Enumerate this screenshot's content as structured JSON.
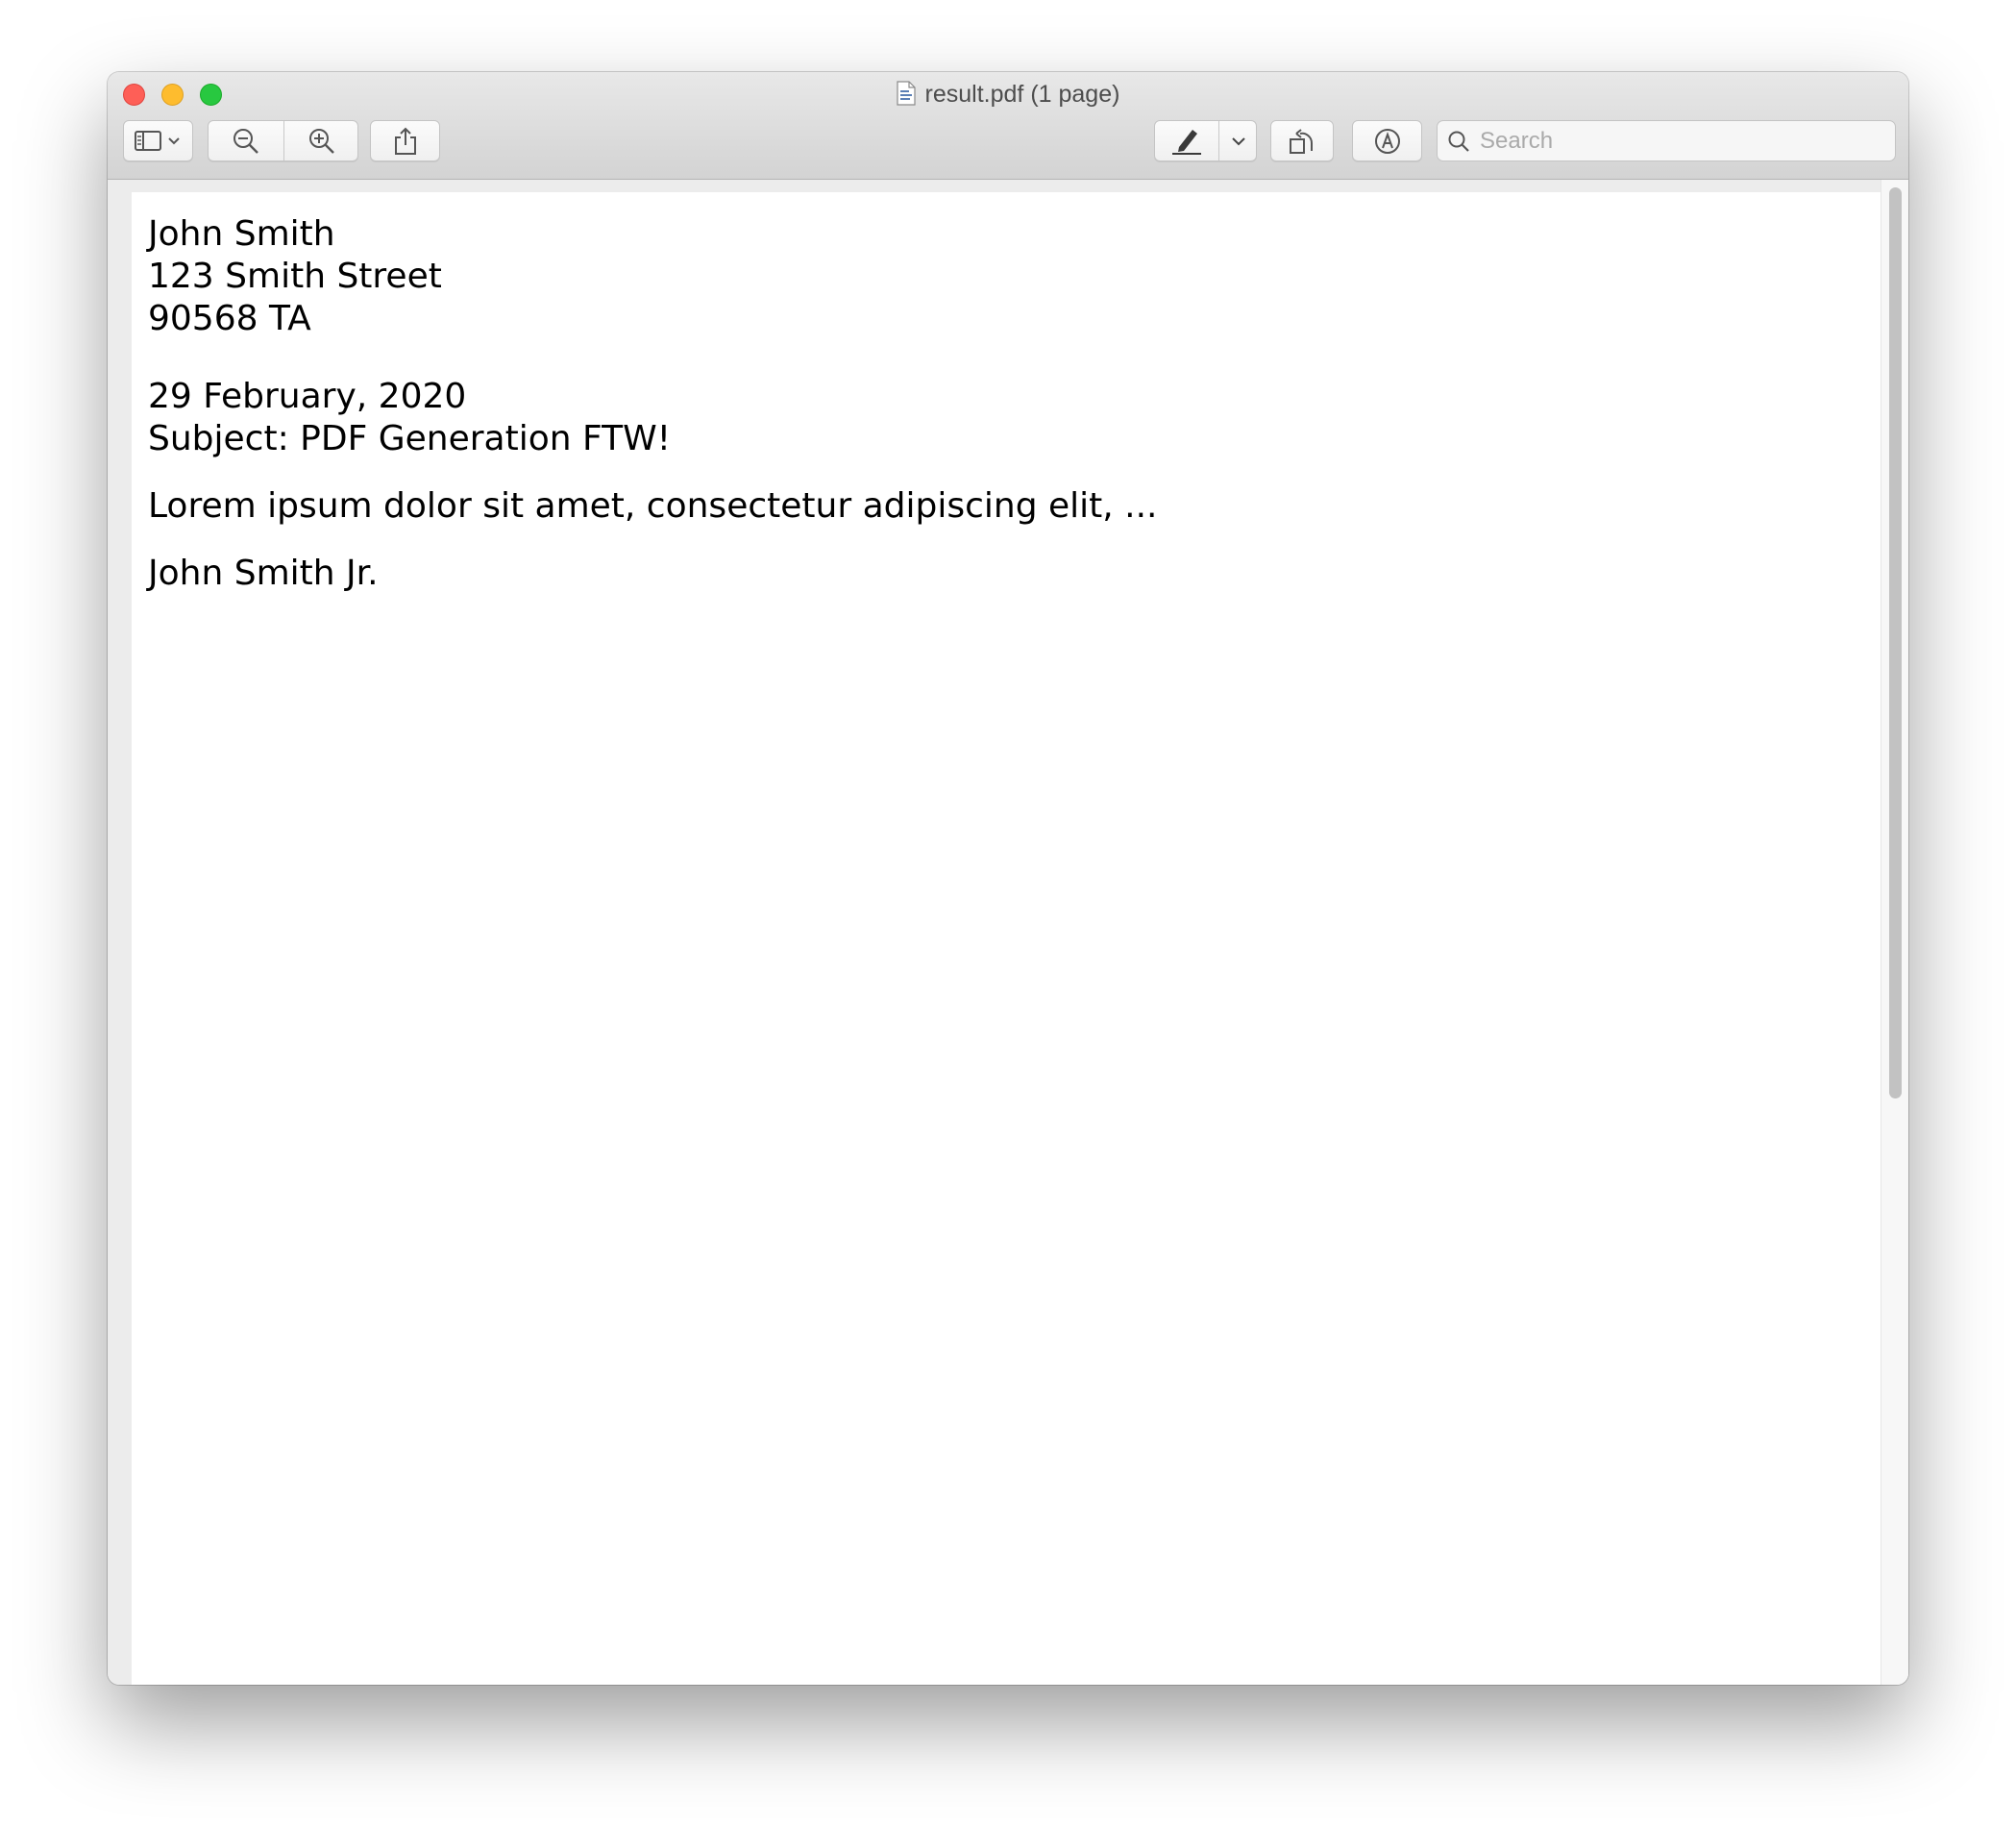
{
  "window": {
    "title": "result.pdf (1 page)"
  },
  "toolbar": {
    "search_placeholder": "Search"
  },
  "document": {
    "sender_name": "John Smith",
    "street": "123 Smith Street",
    "postal": "90568 TA",
    "date": "29 February, 2020",
    "subject": "Subject: PDF Generation FTW!",
    "body": "Lorem ipsum dolor sit amet, consectetur adipiscing elit, ...",
    "signature": "John Smith Jr."
  },
  "colors": {
    "close": "#fe5f57",
    "minimize": "#febc2e",
    "maximize": "#28c840"
  },
  "icons": {
    "sidebar": "sidebar-toggle-icon",
    "zoom_out": "zoom-out-icon",
    "zoom_in": "zoom-in-icon",
    "share": "share-icon",
    "markup": "pen-highlight-icon",
    "rotate": "rotate-icon",
    "annotate": "markup-circle-icon",
    "search": "search-icon"
  }
}
